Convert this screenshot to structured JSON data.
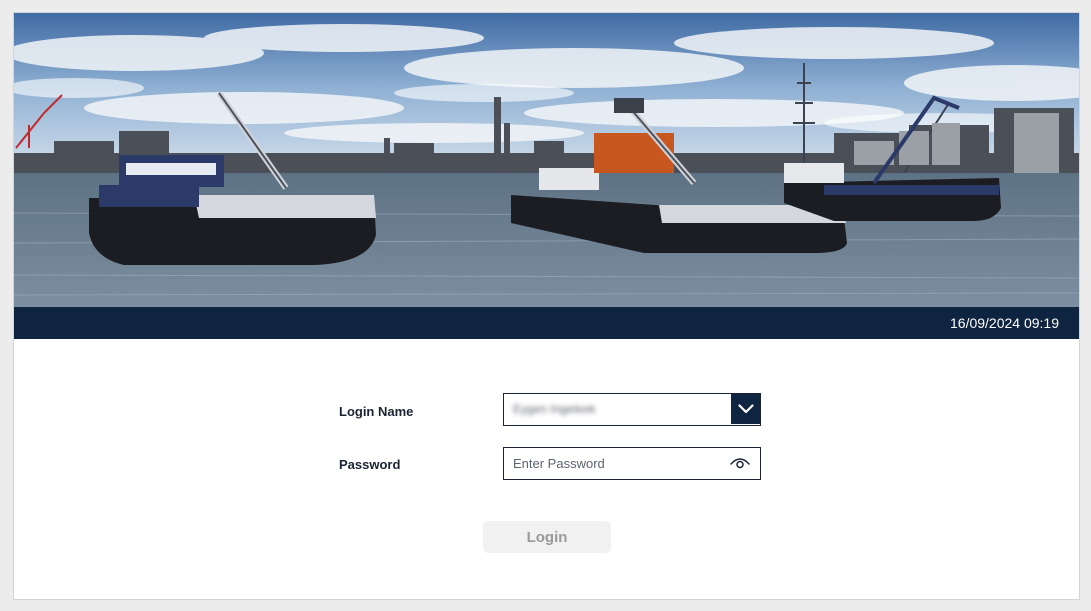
{
  "banner": {
    "image_alt": "Harbour view with barges on the water and industrial port in the background"
  },
  "status_bar": {
    "datetime": "16/09/2024 09:19"
  },
  "form": {
    "login_name": {
      "label": "Login Name",
      "value": "Eygen Ingeleek",
      "value_blurred": true
    },
    "password": {
      "label": "Password",
      "placeholder": "Enter Password",
      "value": ""
    },
    "login_button": {
      "label": "Login",
      "enabled": false
    }
  },
  "icons": {
    "dropdown": "chevron-down-icon",
    "reveal_password": "eye-icon"
  },
  "colors": {
    "navy": "#0f2440",
    "page_background": "#ececec",
    "disabled_button_bg": "#f1f1f1",
    "disabled_button_text": "#9a9a9a"
  }
}
